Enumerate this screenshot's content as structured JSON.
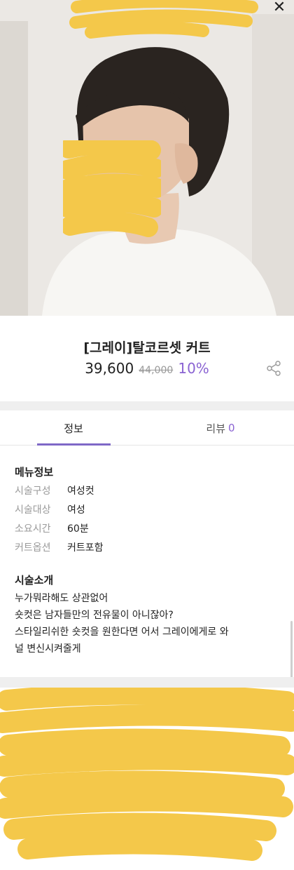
{
  "window": {
    "close_icon": "close-icon"
  },
  "product": {
    "title": "[그레이]탈코르셋 커트",
    "price": "39,600",
    "original_price": "44,000",
    "discount": "10%",
    "share_icon": "share-icon"
  },
  "tabs": [
    {
      "label": "정보",
      "active": true
    },
    {
      "label": "리뷰",
      "count": "0",
      "active": false
    }
  ],
  "menu_info": {
    "title": "메뉴정보",
    "rows": [
      {
        "key": "시술구성",
        "value": "여성컷"
      },
      {
        "key": "시술대상",
        "value": "여성"
      },
      {
        "key": "소요시간",
        "value": "60분"
      },
      {
        "key": "커트옵션",
        "value": "커트포함"
      }
    ]
  },
  "intro": {
    "title": "시술소개",
    "lines": [
      "누가뭐라해도 상관없어",
      "숏컷은 남자들만의 전유물이 아니잖아?",
      "스타일리쉬한 숏컷을 원한다면 어서 그레이에게로 와",
      "널 변신시켜줄게"
    ]
  },
  "colors": {
    "accent": "#8a63d2",
    "tab_underline": "#7f68c7",
    "redaction": "#f4c84a"
  }
}
